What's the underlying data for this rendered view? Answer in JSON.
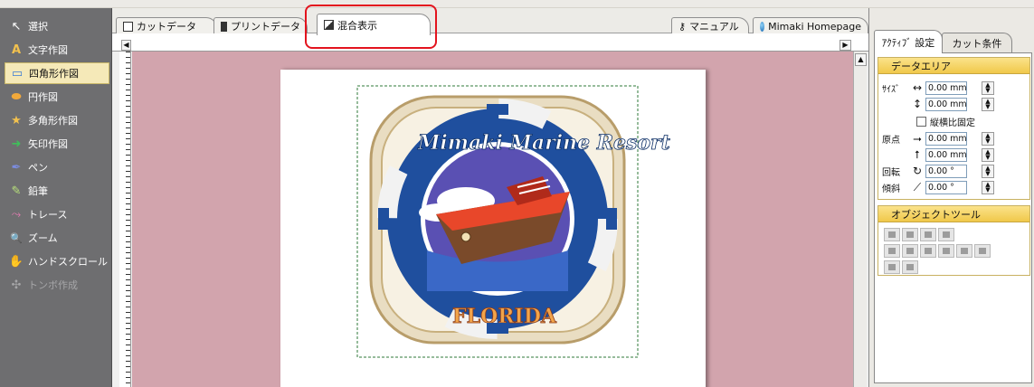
{
  "tools": [
    {
      "label": "選択",
      "icon": "arrow-cursor-icon",
      "glyph": "↖",
      "selected": false,
      "disabled": false
    },
    {
      "label": "文字作図",
      "icon": "text-a-icon",
      "glyph": "A",
      "selected": false,
      "disabled": false
    },
    {
      "label": "四角形作図",
      "icon": "rectangle-icon",
      "glyph": "▭",
      "selected": true,
      "disabled": false
    },
    {
      "label": "円作図",
      "icon": "ellipse-icon",
      "glyph": "⬬",
      "selected": false,
      "disabled": false
    },
    {
      "label": "多角形作図",
      "icon": "star-icon",
      "glyph": "★",
      "selected": false,
      "disabled": false
    },
    {
      "label": "矢印作図",
      "icon": "arrow-right-icon",
      "glyph": "➜",
      "selected": false,
      "disabled": false
    },
    {
      "label": "ペン",
      "icon": "pen-icon",
      "glyph": "✒",
      "selected": false,
      "disabled": false
    },
    {
      "label": "鉛筆",
      "icon": "pencil-icon",
      "glyph": "✎",
      "selected": false,
      "disabled": false
    },
    {
      "label": "トレース",
      "icon": "trace-icon",
      "glyph": "⤳",
      "selected": false,
      "disabled": false
    },
    {
      "label": "ズーム",
      "icon": "zoom-icon",
      "glyph": "🔍",
      "selected": false,
      "disabled": false
    },
    {
      "label": "ハンドスクロール",
      "icon": "hand-icon",
      "glyph": "✋",
      "selected": false,
      "disabled": false
    },
    {
      "label": "トンボ作成",
      "icon": "register-mark-icon",
      "glyph": "✣",
      "selected": false,
      "disabled": true
    }
  ],
  "doc_tabs": [
    {
      "label": "カットデータ",
      "icon": "cut-data-icon",
      "active": false
    },
    {
      "label": "プリントデータ",
      "icon": "print-data-icon",
      "active": false
    },
    {
      "label": "混合表示",
      "icon": "mixed-view-icon",
      "active": true
    }
  ],
  "help_tabs": [
    {
      "label": "マニュアル",
      "icon": "key-icon"
    },
    {
      "label": "Mimaki Homepage",
      "icon": "globe-icon"
    }
  ],
  "right_tabs": [
    {
      "label": "ｱｸﾃｨﾌﾞ 設定",
      "active": true
    },
    {
      "label": "カット条件",
      "active": false
    }
  ],
  "data_area": {
    "title": "データエリア",
    "size_label": "ｻｲｽﾞ",
    "width": "0.00 mm",
    "height": "0.00 mm",
    "keep_ratio_label": "縦横比固定",
    "origin_label": "原点",
    "origin_x": "0.00 mm",
    "origin_y": "0.00 mm",
    "rotate_label": "回転",
    "rotate": "0.00 °",
    "skew_label": "傾斜",
    "skew": "0.00 °"
  },
  "object_tool": {
    "title": "オブジェクトツール"
  },
  "logo": {
    "text_top": "Mimaki Marine Resort",
    "text_bottom": "FLORIDA"
  },
  "colors": {
    "canvas_bg": "#d2a4ad",
    "toolbar_bg": "#6e6e70",
    "highlight": "#e3141e",
    "group_header": "#f4d263"
  }
}
